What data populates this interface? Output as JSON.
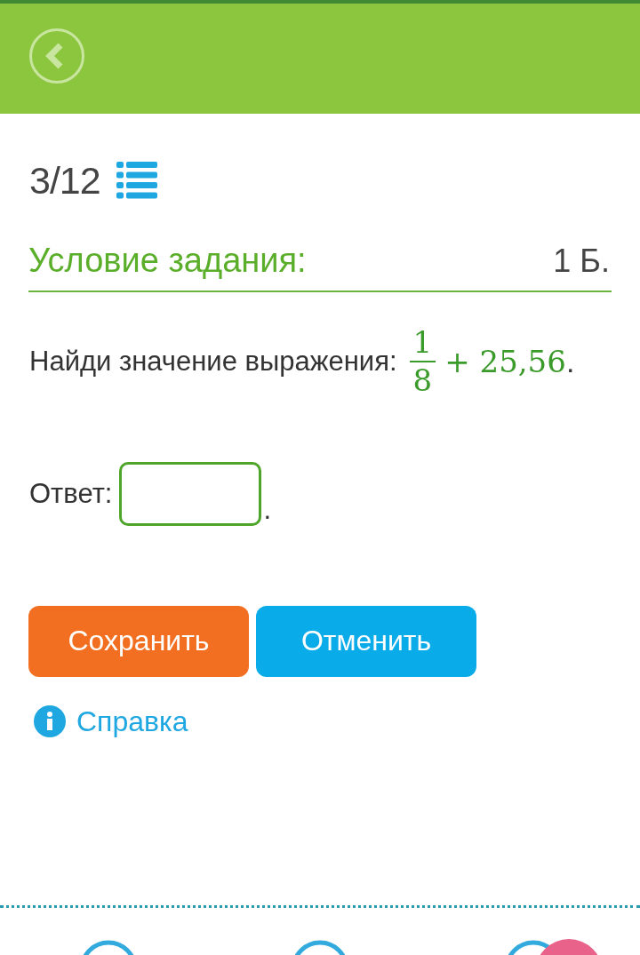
{
  "progress": {
    "counter": "3/12"
  },
  "task": {
    "heading": "Условие задания:",
    "points": "1 Б.",
    "question": "Найди значение выражения:",
    "numerator": "1",
    "denominator": "8",
    "expression_rest": "+ 25,56",
    "end_mark": "."
  },
  "answer": {
    "label": "Ответ:",
    "end_mark": "."
  },
  "buttons": [
    {
      "label": "Сохранить",
      "kind": "primary"
    },
    {
      "label": "Отменить",
      "kind": "secondary"
    }
  ],
  "help_link": "Справка"
}
